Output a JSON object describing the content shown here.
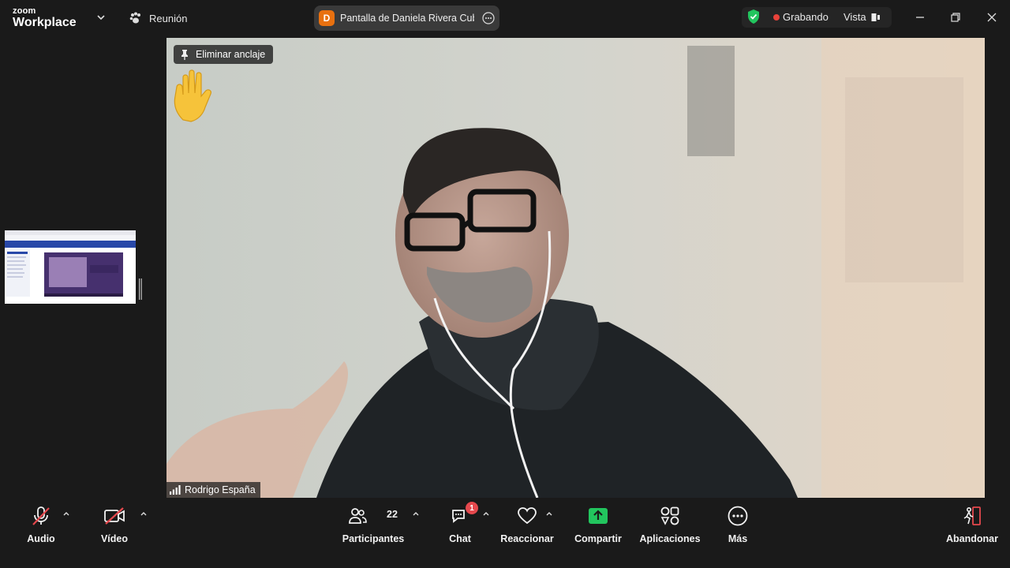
{
  "app": {
    "brand_top": "zoom",
    "brand_bottom": "Workplace"
  },
  "meeting": {
    "label": "Reunión"
  },
  "share": {
    "avatar_letter": "D",
    "title": "Pantalla de Daniela Rivera Cubillos",
    "avatar_color": "#e8700f"
  },
  "status": {
    "recording_label": "Grabando",
    "view_label": "Vista",
    "shield_color": "#22c55e",
    "rec_color": "#e8423a"
  },
  "stage": {
    "unpin_label": "Eliminar anclaje",
    "participant_name": "Rodrigo España",
    "reaction": "raised-hand"
  },
  "toolbar": {
    "audio": "Audio",
    "video": "Vídeo",
    "participants": "Participantes",
    "participants_count": "22",
    "chat": "Chat",
    "chat_badge": "1",
    "react": "Reaccionar",
    "share": "Compartir",
    "apps": "Aplicaciones",
    "more": "Más",
    "leave": "Abandonar"
  },
  "colors": {
    "accent_green": "#22c55e",
    "danger": "#e5484d",
    "background": "#1a1a1a"
  }
}
